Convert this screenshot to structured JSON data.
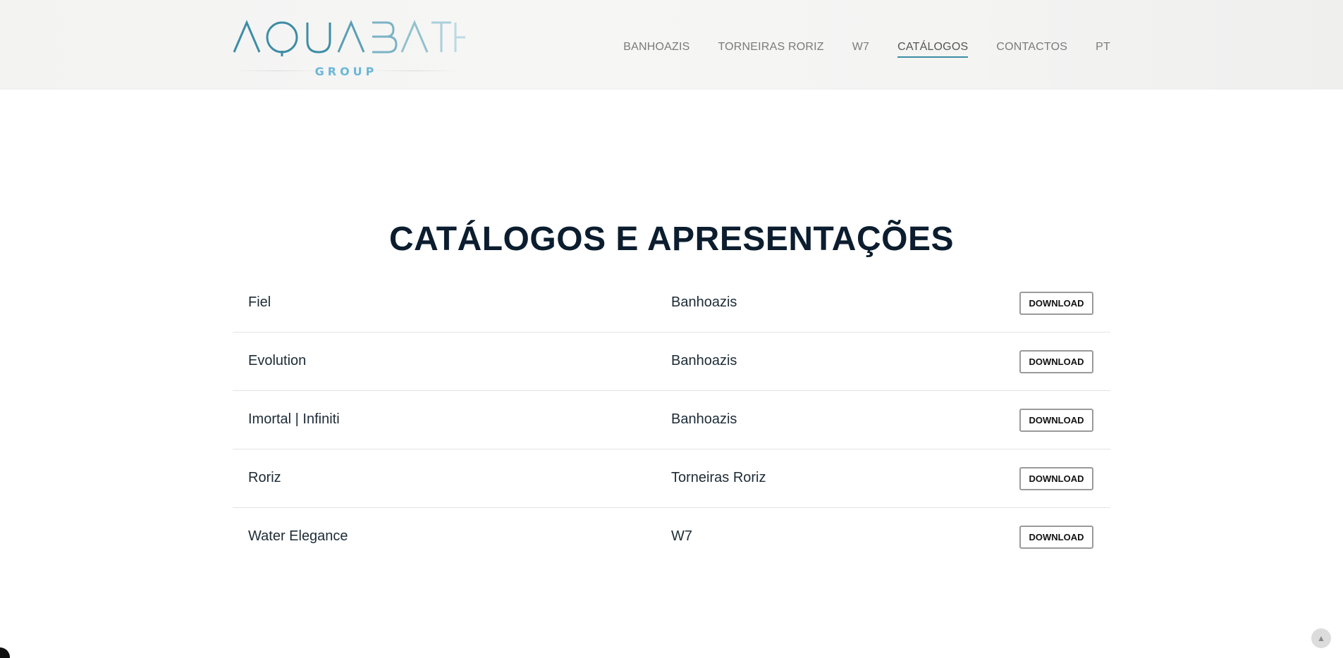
{
  "brand": {
    "logo_text": "AQUABATH",
    "logo_sub": "GROUP",
    "colors": {
      "primary": "#3d8da5",
      "light": "#a9cfdc",
      "sub": "#6bb7d8"
    }
  },
  "nav": {
    "items": [
      {
        "label": "BANHOAZIS",
        "active": false
      },
      {
        "label": "TORNEIRAS RORIZ",
        "active": false
      },
      {
        "label": "W7",
        "active": false
      },
      {
        "label": "CATÁLOGOS",
        "active": true
      },
      {
        "label": "CONTACTOS",
        "active": false
      },
      {
        "label": "PT",
        "active": false
      }
    ]
  },
  "main": {
    "title": "CATÁLOGOS E APRESENTAÇÕES",
    "download_label": "DOWNLOAD",
    "catalogs": [
      {
        "name": "Fiel",
        "brand": "Banhoazis"
      },
      {
        "name": "Evolution",
        "brand": "Banhoazis"
      },
      {
        "name": "Imortal | Infiniti",
        "brand": "Banhoazis"
      },
      {
        "name": "Roriz",
        "brand": "Torneiras Roriz"
      },
      {
        "name": "Water Elegance",
        "brand": "W7"
      }
    ]
  },
  "footer": {
    "scroll_top_icon": "chevron-up-icon"
  }
}
